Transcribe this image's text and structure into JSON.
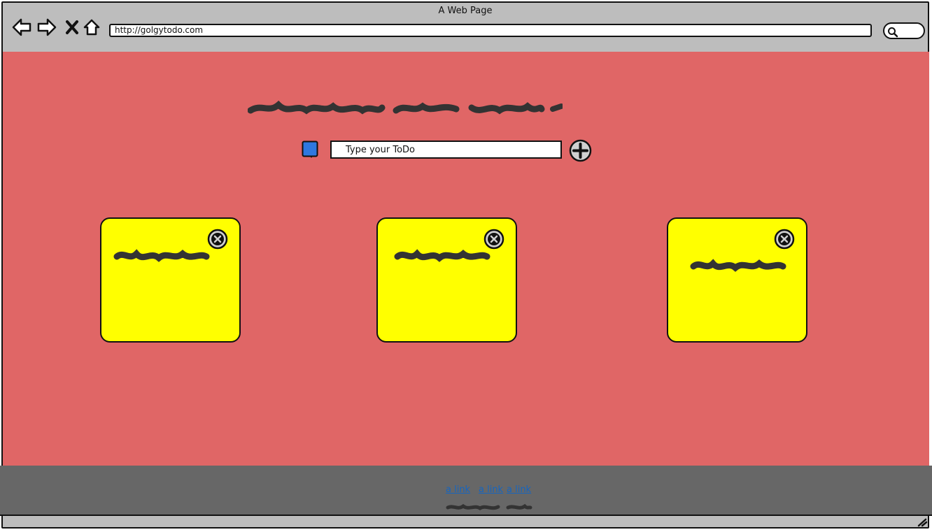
{
  "window": {
    "title": "A Web Page",
    "url": "http://golgytodo.com"
  },
  "toolbar": {
    "back_icon": "back-arrow-icon",
    "forward_icon": "forward-arrow-icon",
    "stop_icon": "close-x-icon",
    "home_icon": "home-icon",
    "search_icon": "search-icon"
  },
  "todo_form": {
    "placeholder": "Type your ToDo",
    "value": "",
    "add_icon": "plus-circle-icon",
    "note_icon": "note-icon"
  },
  "notes": [
    {
      "delete_icon": "close-circle-icon"
    },
    {
      "delete_icon": "close-circle-icon"
    },
    {
      "delete_icon": "close-circle-icon"
    }
  ],
  "footer": {
    "links": [
      "a link",
      "a link",
      "a link"
    ]
  },
  "colors": {
    "background": "#e06666",
    "note": "#ffff00",
    "chrome": "#bdbdbd",
    "footer": "#676767",
    "link": "#1565c0",
    "note_icon": "#2f78e0"
  }
}
